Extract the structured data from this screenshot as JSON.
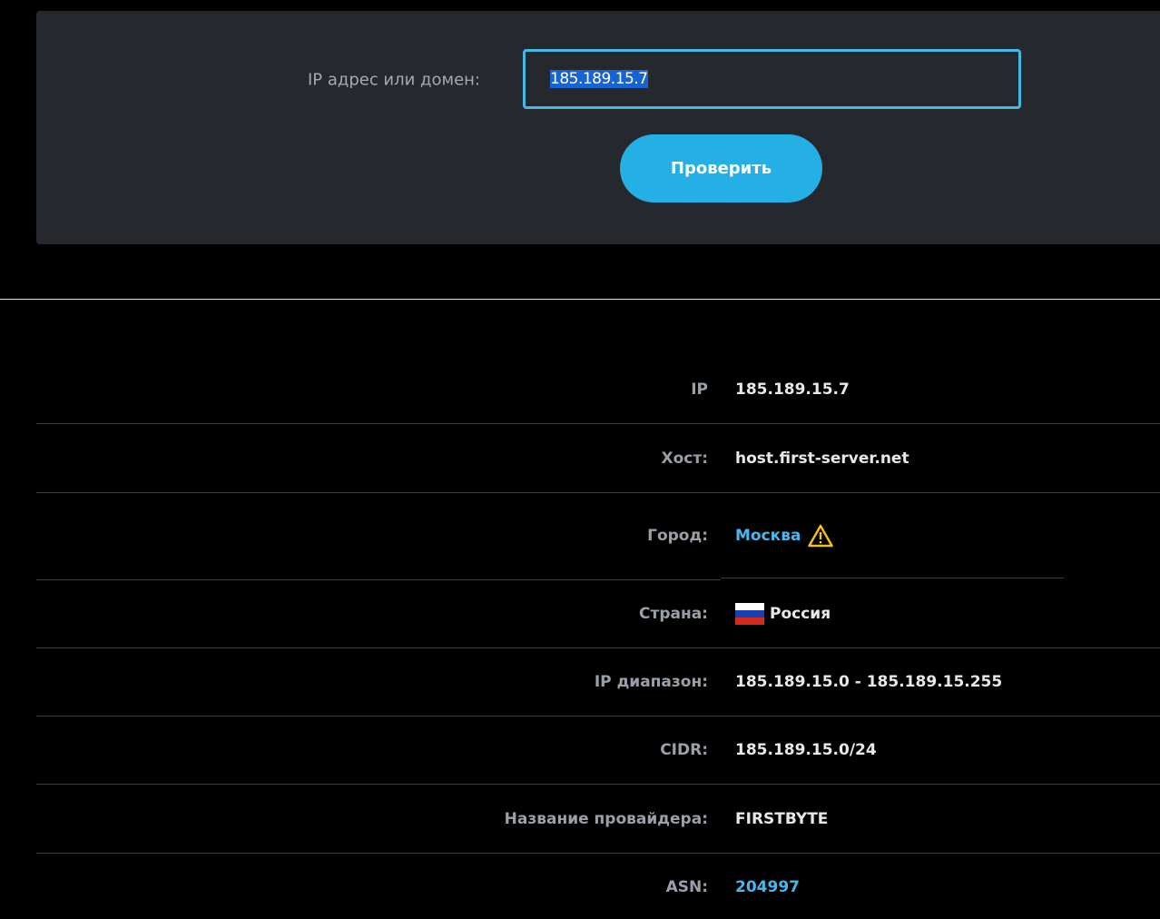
{
  "search": {
    "label": "IP адрес или домен:",
    "value": "185.189.15.7",
    "button_label": "Проверить"
  },
  "info": {
    "rows": [
      {
        "label": "IP",
        "value": "185.189.15.7"
      },
      {
        "label": "Хост:",
        "value": "host.first-server.net"
      },
      {
        "label": "Город:",
        "value": "Москва"
      },
      {
        "label": "Страна:",
        "value": "Россия"
      },
      {
        "label": "IP диапазон:",
        "value": "185.189.15.0 - 185.189.15.255"
      },
      {
        "label": "CIDR:",
        "value": "185.189.15.0/24"
      },
      {
        "label": "Название провайдера:",
        "value": "FIRSTBYTE"
      },
      {
        "label": "ASN:",
        "value": "204997"
      }
    ]
  },
  "icons": {
    "city_warning": "warning-triangle-icon",
    "country_flag": "russia-flag-icon"
  },
  "colors": {
    "accent": "#24afe5",
    "link": "#4ab7ec",
    "warning": "#f2c21b",
    "panel_bg": "#25282d",
    "page_bg": "#000000"
  }
}
